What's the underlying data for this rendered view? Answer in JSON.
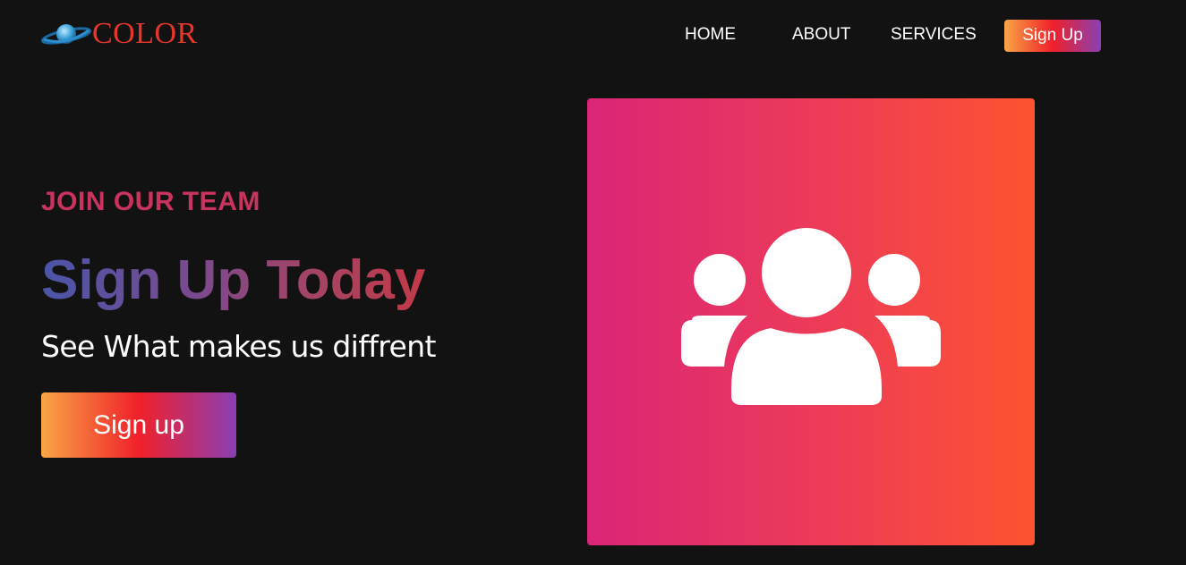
{
  "brand": {
    "logo_text": "COLOR",
    "logo_icon": "planet-icon"
  },
  "nav": {
    "items": [
      {
        "label": "HOME"
      },
      {
        "label": "ABOUT"
      },
      {
        "label": "SERVICES"
      }
    ],
    "signup_label": "Sign Up"
  },
  "hero": {
    "eyebrow": "JOIN OUR TEAM",
    "headline": "Sign Up Today",
    "subhead": "See What makes us diffrent",
    "cta_label": "Sign up",
    "illustration_icon": "users-group-icon"
  },
  "colors": {
    "background": "#121212",
    "accent_orange": "#f9a645",
    "accent_red": "#f0202a",
    "accent_purple": "#8a3fb4",
    "card_pink": "#db2577",
    "card_orange": "#fe5330"
  }
}
